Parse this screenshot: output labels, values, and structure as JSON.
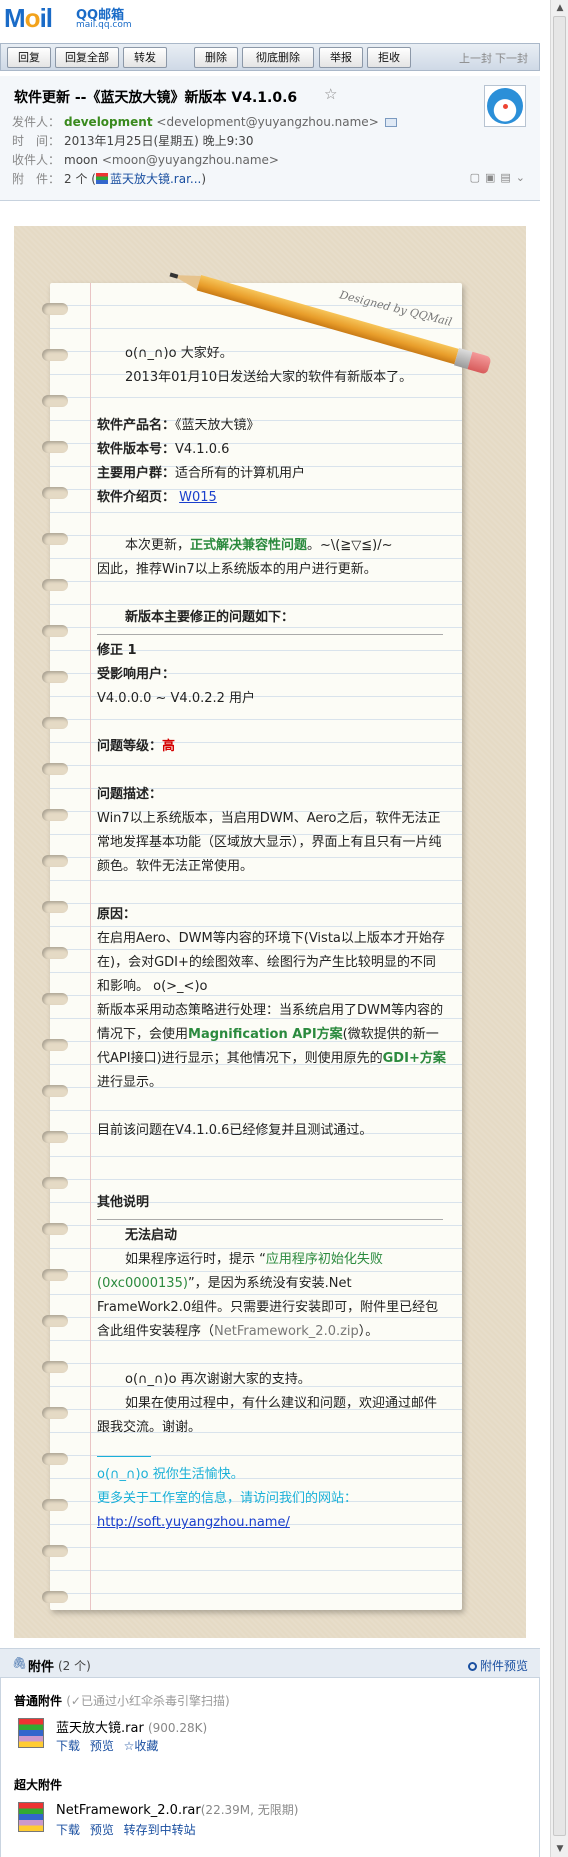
{
  "logo": {
    "text_prefix": "M",
    "text_o": "o",
    "text_suffix": "il",
    "cn": "QQ邮箱",
    "url": "mail.qq.com"
  },
  "toolbar": {
    "buttons": [
      "回复",
      "回复全部",
      "转发",
      "删除",
      "彻底删除",
      "举报",
      "拒收"
    ],
    "prev": "上一封",
    "next": "下一封"
  },
  "header": {
    "subject": "软件更新 --《蓝天放大镜》新版本 V4.1.0.6",
    "from_label": "发件人：",
    "from_name": "development",
    "from_addr": "<development@yuyangzhou.name>",
    "time_label": "时　间：",
    "time": "2013年1月25日(星期五) 晚上9:30",
    "to_label": "收件人：",
    "to_name": "moon",
    "to_addr": "<moon@yuyangzhou.name>",
    "att_label": "附　件：",
    "att_count": "2 个",
    "att_open": "(",
    "att_file": "蓝天放大镜.rar...",
    "att_close": ")"
  },
  "paper": {
    "designed": "Designed by QQMail",
    "greeting": "o(∩_∩)o  大家好。",
    "intro": "2013年01月10日发送给大家的软件有新版本了。",
    "product_label": "软件产品名：",
    "product_value": "《蓝天放大镜》",
    "version_label": "软件版本号：",
    "version_value": "V4.1.0.6",
    "users_label": "主要用户群：",
    "users_value": "适合所有的计算机用户",
    "intro_page_label": "软件介绍页：",
    "intro_page_link": "W015",
    "update_pre": "本次更新，",
    "update_green": "正式解决兼容性问题",
    "update_post": "。~\\(≧▽≦)/~",
    "update_line2": "因此，推荐Win7以上系统版本的用户进行更新。",
    "fixes_title": "新版本主要修正的问题如下：",
    "fix1": "修正 1",
    "affected_label": "受影响用户：",
    "affected_value": "V4.0.0.0 ~ V4.0.2.2  用户",
    "level_label": "问题等级：",
    "level_value": "高",
    "desc_label": "问题描述：",
    "desc_text": "Win7以上系统版本，当启用DWM、Aero之后，软件无法正常地发挥基本功能（区域放大显示），界面上有且只有一片纯颜色。软件无法正常使用。",
    "reason_label": "原因：",
    "reason_text": "在启用Aero、DWM等内容的环境下(Vista以上版本才开始存在)，会对GDI+的绘图效率、绘图行为产生比较明显的不同和影响。  o(>_<)o",
    "reason2_pre": "新版本采用动态策略进行处理：当系统启用了DWM等内容的情况下，会使用",
    "reason2_green1": "Magnification API方案",
    "reason2_mid": "(微软提供的新一代API接口)进行显示；其他情况下，则使用原先的",
    "reason2_green2": "GDI+方案",
    "reason2_post": "进行显示。",
    "fixed_note": "目前该问题在V4.1.0.6已经修复并且测试通过。",
    "other_title": "其他说明",
    "cannot_start": "无法启动",
    "start_pre": "如果程序运行时，提示 “",
    "start_green": "应用程序初始化失败(0xc0000135)",
    "start_mid": "”，是因为系统没有安装.Net FrameWork2.0组件。只需要进行安装即可，附件里已经包含此组件安装程序（",
    "start_gray": "NetFramework_2.0.zip",
    "start_post": "）。",
    "thanks": "o(∩_∩)o 再次谢谢大家的支持。",
    "feedback": "如果在使用过程中，有什么建议和问题，欢迎通过邮件跟我交流。谢谢。",
    "sig_line": "o(∩_∩)o  祝你生活愉快。",
    "sig_more": "更多关于工作室的信息，请访问我们的网站：",
    "sig_url": "http://soft.yuyangzhou.name/"
  },
  "attachments": {
    "title": "附件",
    "count": "(2 个)",
    "preview": "附件预览",
    "normal_title": "普通附件",
    "normal_note": "(✓已通过小红伞杀毒引擎扫描)",
    "file1_name": "蓝天放大镜.rar",
    "file1_size": "(900.28K)",
    "file1_actions": "下载  预览  ☆收藏",
    "super_title": "超大附件",
    "file2_name": "NetFramework_2.0.rar",
    "file2_size": "(22.39M, 无限期)",
    "file2_actions": "下载  预览  转存到中转站"
  }
}
